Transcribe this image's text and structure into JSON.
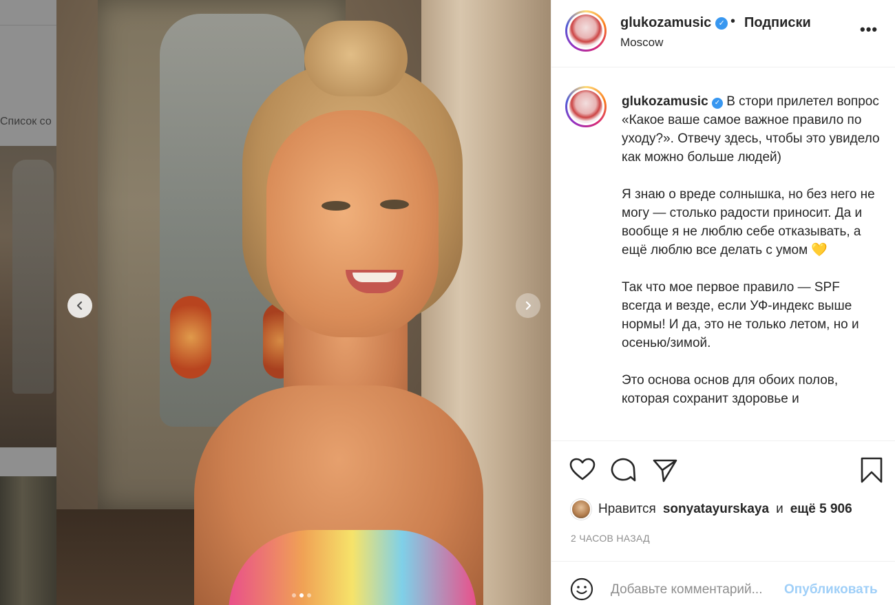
{
  "background": {
    "list_label": "Список со"
  },
  "post": {
    "username": "glukozamusic",
    "follow_label": "Подписки",
    "separator": "•",
    "location": "Moscow",
    "more": "•••",
    "caption_paragraphs": [
      "В стори прилетел вопрос «Какое ваше самое важное правило по уходу?». Отвечу здесь, чтобы это увидело как можно больше людей)",
      "Я знаю о вреде солнышка, но без него не могу — столько радости приносит. Да и вообще я не люблю себе отказывать, а ещё люблю все делать с умом 💛",
      "Так что мое первое правило — SPF всегда и везде, если УФ-индекс выше нормы! И да, это не только летом, но и осенью/зимой.",
      "Это основа основ для обоих полов, которая сохранит здоровье и"
    ],
    "likes": {
      "prefix": "Нравится",
      "user": "sonyatayurskaya",
      "and": "и",
      "more": "ещё 5 906"
    },
    "time": "2 ЧАСОВ НАЗАД",
    "comment_placeholder": "Добавьте комментарий...",
    "publish_label": "Опубликовать",
    "carousel": {
      "count": 3,
      "active": 2
    }
  },
  "icons": [
    "like-icon",
    "comment-icon",
    "share-icon",
    "save-icon",
    "emoji-icon",
    "chevron-left-icon",
    "chevron-right-icon",
    "verified-icon",
    "more-icon"
  ],
  "colors": {
    "link_blue": "#3897f0",
    "publish_disabled": "#9fcff8",
    "text": "#262626",
    "muted": "#8e8e8e"
  }
}
